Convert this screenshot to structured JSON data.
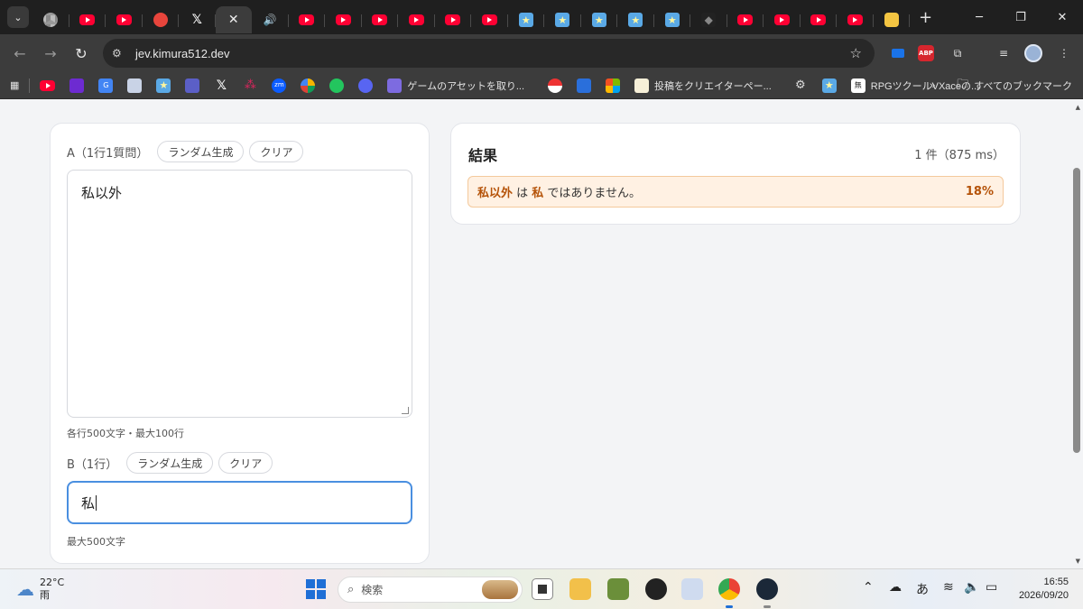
{
  "browser": {
    "tabs": [
      {
        "icon": "chrome-icon",
        "kind": "chrome"
      },
      {
        "icon": "youtube-icon",
        "kind": "yt"
      },
      {
        "icon": "youtube-icon",
        "kind": "yt"
      },
      {
        "icon": "google-icon",
        "kind": "g"
      },
      {
        "icon": "x-icon",
        "kind": "x"
      },
      {
        "icon": "close-icon",
        "kind": "active"
      },
      {
        "icon": "audio-icon",
        "kind": "audio"
      },
      {
        "icon": "youtube-icon",
        "kind": "yt"
      },
      {
        "icon": "youtube-icon",
        "kind": "yt"
      },
      {
        "icon": "youtube-icon",
        "kind": "yt"
      },
      {
        "icon": "youtube-icon",
        "kind": "yt"
      },
      {
        "icon": "youtube-icon",
        "kind": "yt"
      },
      {
        "icon": "youtube-icon",
        "kind": "yt"
      },
      {
        "icon": "star-icon",
        "kind": "star"
      },
      {
        "icon": "star-icon",
        "kind": "star"
      },
      {
        "icon": "star-icon",
        "kind": "star"
      },
      {
        "icon": "star-icon",
        "kind": "star"
      },
      {
        "icon": "star-icon",
        "kind": "star"
      },
      {
        "icon": "dark-app-icon",
        "kind": "dark"
      },
      {
        "icon": "youtube-icon",
        "kind": "yt"
      },
      {
        "icon": "youtube-icon",
        "kind": "yt"
      },
      {
        "icon": "youtube-icon",
        "kind": "yt"
      },
      {
        "icon": "youtube-icon",
        "kind": "yt"
      },
      {
        "icon": "yellow-app-icon",
        "kind": "yellow"
      }
    ],
    "url": "jev.kimura512.dev",
    "bookmarks": {
      "game_assets": "ゲームのアセットを取り...",
      "creator": "投稿をクリエイターペー...",
      "rpg": "RPGツクールVXaceの...",
      "folder_label": "すべてのブックマーク"
    }
  },
  "app": {
    "field_a": {
      "label": "A（1行1質問）",
      "random_label": "ランダム生成",
      "clear_label": "クリア",
      "value": "私以外",
      "hint": "各行500文字・最大100行"
    },
    "field_b": {
      "label": "B（1行）",
      "random_label": "ランダム生成",
      "clear_label": "クリア",
      "value": "私",
      "hint": "最大500文字"
    },
    "result": {
      "title": "結果",
      "count": "1 件（875 ms）",
      "row": {
        "a_term": "私以外",
        "connector": " は ",
        "b_term": "私",
        "suffix": " ではありません。",
        "percent": "18%"
      }
    }
  },
  "taskbar": {
    "weather_temp": "22°C",
    "weather_desc": "雨",
    "search_placeholder": "検索",
    "ime": "あ",
    "time": "16:55",
    "date": "2026/09/20"
  }
}
